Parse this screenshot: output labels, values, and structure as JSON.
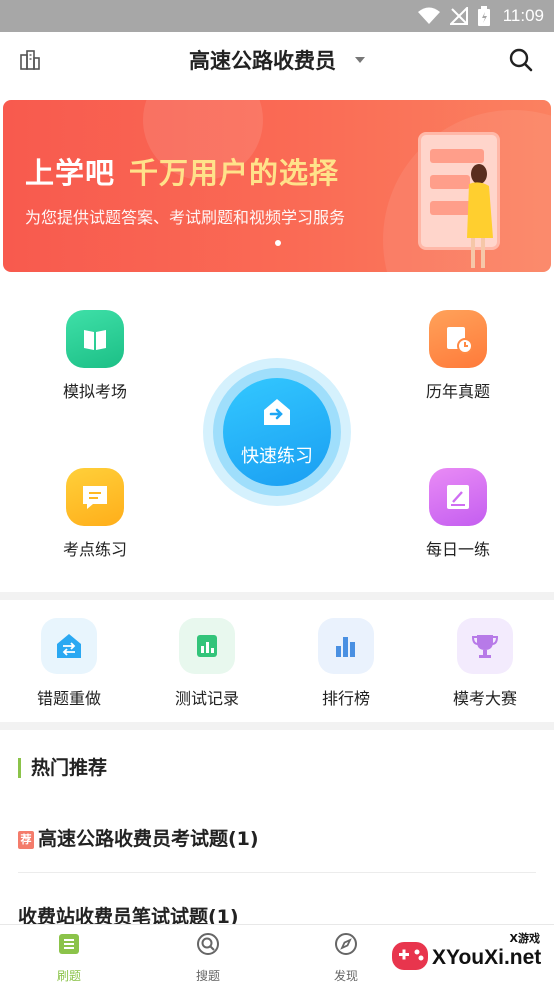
{
  "status_bar": {
    "time": "11:09"
  },
  "app_bar": {
    "title": "高速公路收费员",
    "left_icon": "buildings-icon",
    "right_icon": "search-icon"
  },
  "banner": {
    "brand": "上学吧",
    "slogan": "千万用户的选择",
    "subtitle": "为您提供试题答案、考试刷题和视频学习服务"
  },
  "features": {
    "mock_exam": "模拟考场",
    "past_papers": "历年真题",
    "quick_practice": "快速练习",
    "key_points": "考点练习",
    "daily": "每日一练"
  },
  "tools": {
    "wrong_redo": "错题重做",
    "test_records": "测试记录",
    "ranking": "排行榜",
    "mock_contest": "模考大赛"
  },
  "hot": {
    "title": "热门推荐",
    "items": [
      {
        "tag": "荐",
        "title": "高速公路收费员考试题(1)"
      },
      {
        "title": "收费站收费员笔试试题(1)"
      }
    ]
  },
  "tabbar": {
    "tabs": [
      {
        "label": "刷题",
        "icon": "list-icon"
      },
      {
        "label": "搜题",
        "icon": "search-circle-icon"
      },
      {
        "label": "发现",
        "icon": "compass-icon"
      }
    ]
  },
  "watermark": {
    "small": "X游戏",
    "large": "XYouXi.net"
  },
  "colors": {
    "accent_green": "#8bc34a",
    "banner_red": "#f85a4e",
    "quick_blue": "#1a9ef2"
  }
}
